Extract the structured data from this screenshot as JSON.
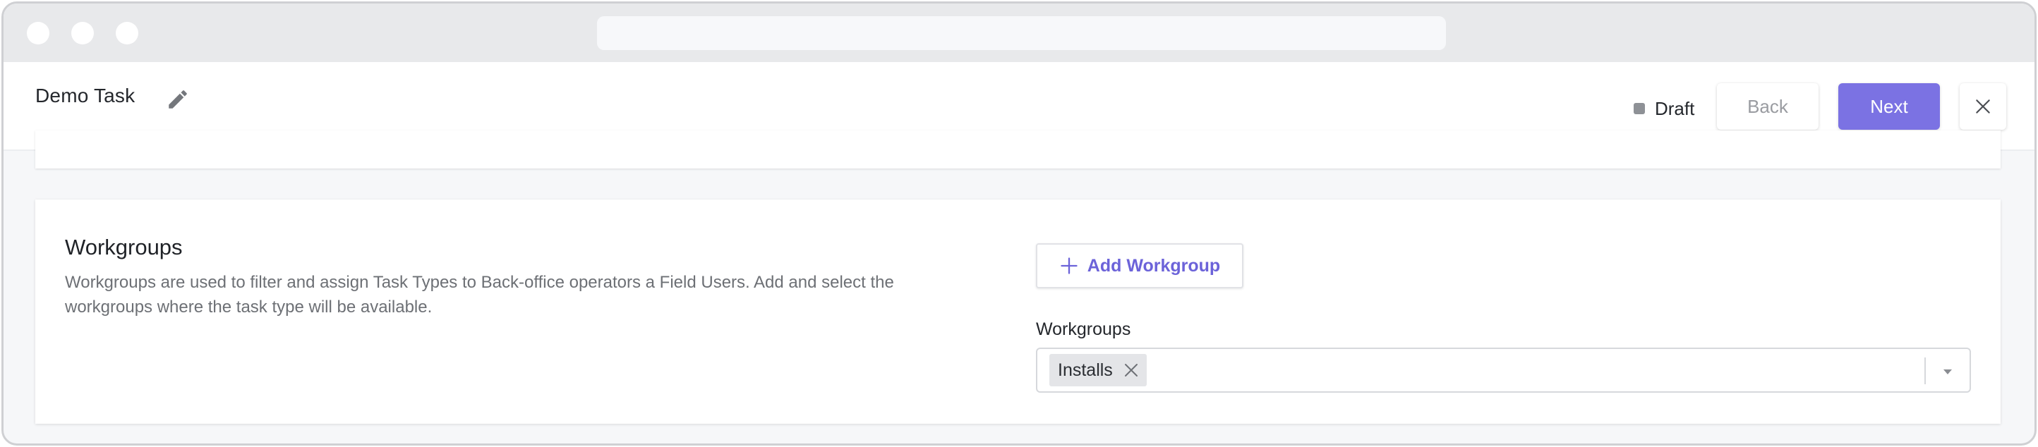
{
  "header": {
    "title": "Demo Task",
    "status": "Draft",
    "back_label": "Back",
    "next_label": "Next"
  },
  "workgroups_section": {
    "title": "Workgroups",
    "description": "Workgroups are used to filter and assign Task Types to Back-office operators a Field Users. Add and select the workgroups where the task type will be available.",
    "add_button_label": "Add Workgroup",
    "field_label": "Workgroups",
    "selected": [
      "Installs"
    ]
  },
  "icons": {
    "edit": "pencil-icon",
    "close": "close-icon",
    "add": "plus-icon",
    "remove_chip": "close-icon",
    "dropdown": "caret-down-icon"
  },
  "colors": {
    "accent": "#7b72e3",
    "accent_text": "#6c63d9",
    "status_dot": "#8e9196"
  }
}
